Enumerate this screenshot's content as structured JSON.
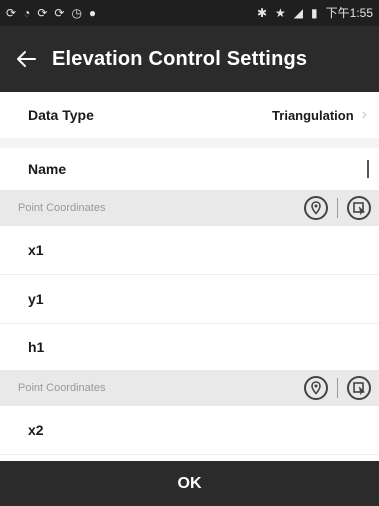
{
  "status_bar": {
    "time": "下午1:55",
    "icons": [
      "sync-icon",
      "wifi-icon",
      "sync-icon",
      "sync-icon",
      "alarm-icon",
      "location-pin-icon",
      "bluetooth-icon",
      "star-icon",
      "signal-icon",
      "battery-icon"
    ]
  },
  "header": {
    "title": "Elevation Control Settings",
    "back_icon": "back-arrow-icon"
  },
  "form": {
    "data_type_label": "Data Type",
    "data_type_value": "Triangulation",
    "name_label": "Name",
    "name_value": "",
    "section1_label": "Point Coordinates",
    "x1_label": "x1",
    "y1_label": "y1",
    "h1_label": "h1",
    "section2_label": "Point Coordinates",
    "x2_label": "x2"
  },
  "footer": {
    "ok_label": "OK"
  },
  "colors": {
    "header_bg": "#2b2b2b",
    "status_bg": "#1f1f1f",
    "section_bg": "#e9e9e9"
  }
}
